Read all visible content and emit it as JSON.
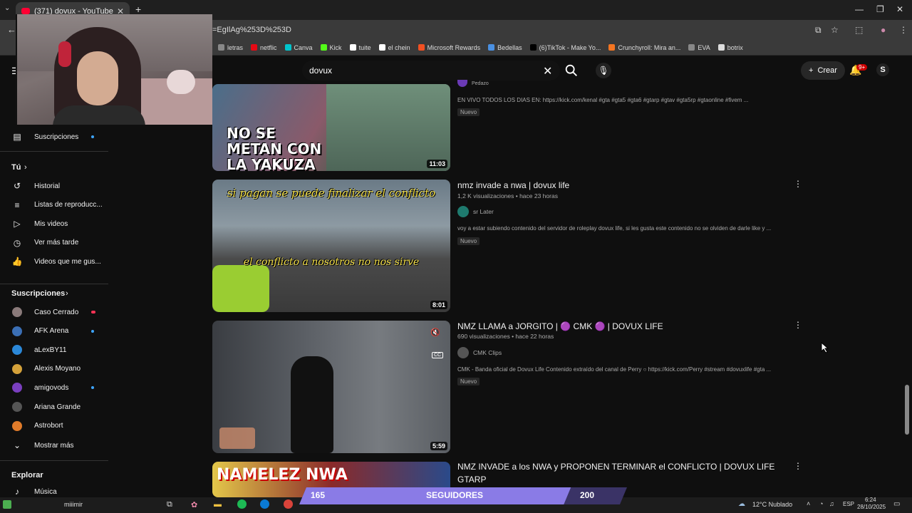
{
  "browser": {
    "tab_title": "(371) dovux - YouTube",
    "url": "=EgIlAg%253D%253D",
    "bookmarks": [
      "letras",
      "netflic",
      "Canva",
      "Kick",
      "tuite",
      "el chein",
      "Microsoft Rewards",
      "Bedellas",
      "(6)TikTok - Make Yo...",
      "Crunchyroll: Mira an...",
      "EVA",
      "botrix"
    ],
    "bookmark_colors": [
      "#888888",
      "#e50914",
      "#00c4cc",
      "#53fc18",
      "#ffffff",
      "#ffffff",
      "#f25022",
      "#4a90e2",
      "#000000",
      "#f47521",
      "#888888",
      "#dddddd"
    ]
  },
  "header": {
    "search_value": "dovux",
    "create_label": "Crear",
    "notif_badge": "9+",
    "avatar_letter": "S"
  },
  "sidebar": {
    "subscriptions_link": "Suscripciones",
    "you_label": "Tú",
    "you_items": [
      {
        "label": "Historial",
        "icon": "history-icon"
      },
      {
        "label": "Listas de reproducc...",
        "icon": "playlist-icon"
      },
      {
        "label": "Mis videos",
        "icon": "my-videos-icon"
      },
      {
        "label": "Ver más tarde",
        "icon": "watch-later-icon"
      },
      {
        "label": "Videos que me gus...",
        "icon": "liked-icon"
      }
    ],
    "subs_heading": "Suscripciones",
    "subs": [
      {
        "label": "Caso Cerrado",
        "color": "#8a7a7a",
        "live": "red"
      },
      {
        "label": "AFK Arena",
        "color": "#3b6fb5",
        "live": "dot"
      },
      {
        "label": "aLexBY11",
        "color": "#2b88d8",
        "live": ""
      },
      {
        "label": "Alexis Moyano",
        "color": "#d4a13a",
        "live": ""
      },
      {
        "label": "amigovods",
        "color": "#7a3fbf",
        "live": "dot"
      },
      {
        "label": "Ariana Grande",
        "color": "#555555",
        "live": ""
      },
      {
        "label": "Astrobort",
        "color": "#e07b2a",
        "live": ""
      }
    ],
    "show_more": "Mostrar más",
    "explore_heading": "Explorar",
    "music_label": "Música"
  },
  "results": [
    {
      "title": "",
      "channel": "Pedazo",
      "views": "",
      "description": "EN VIVO TODOS LOS DIAS EN: https://kick.com/kenal #gta #gta5 #gta6 #gtarp #gtav #gta5rp #gtaonline #fivem ...",
      "badge": "Nuevo",
      "duration": "11:03",
      "thumb_text": "NO SE METAN CON LA YAKUZA"
    },
    {
      "title": "nmz invade a nwa | dovux life",
      "views": "1,2 K visualizaciones • hace 23 horas",
      "channel": "sr Later",
      "description": "voy a estar subiendo contenido del servidor de roleplay dovux life, si les gusta este contenido no se olviden de darle like y ...",
      "badge": "Nuevo",
      "duration": "8:01",
      "thumb_top": "si pagan se puede finalizar el conflicto",
      "thumb_bottom": "el conflicto a nosotros no nos sirve"
    },
    {
      "title": "NMZ LLAMA a JORGITO | 🟣 CMK 🟣 | DOVUX LIFE",
      "views": "690 visualizaciones • hace 22 horas",
      "channel": "CMK Clips",
      "description": "CMK - Banda oficial de Dovux Life Contenido extraído del canal de Perry ○ https://kick.com/Perry #stream #dovuxlife #gta ...",
      "badge": "Nuevo",
      "duration": "5:59"
    },
    {
      "title": "NMZ INVADE a los NWA y PROPONEN TERMINAR el CONFLICTO | DOVUX LIFE",
      "title2": "GTARP",
      "thumb_text": "NAMELEZ NWA"
    }
  ],
  "overlay": {
    "followers_current": "165",
    "followers_label": "SEGUIDORES",
    "followers_goal": "200",
    "followers_fraction": 0.825
  },
  "taskbar": {
    "weather": "12°C Nublado",
    "lang": "ESP",
    "time": "6:24",
    "date": "28/10/2025",
    "now_playing": "miiimir"
  }
}
